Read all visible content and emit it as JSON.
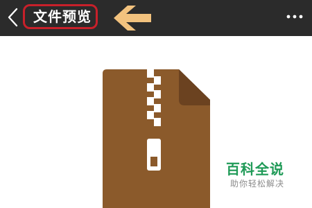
{
  "header": {
    "title": "文件预览",
    "back_icon": "chevron-left-icon",
    "more_icon": "more-horizontal-icon",
    "highlight_color": "#c8202a",
    "pointer_arrow_color": "#f2c27e"
  },
  "content": {
    "file_icon": "zip-archive-file-icon",
    "file_icon_color": "#8b5a2b"
  },
  "watermark": {
    "title": "百科全说",
    "subtitle": "助你轻松解决",
    "color": "#1f9a57"
  }
}
